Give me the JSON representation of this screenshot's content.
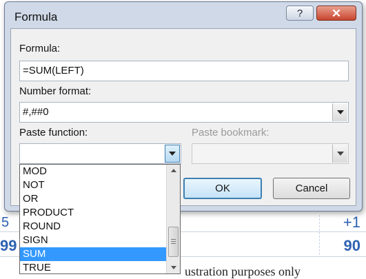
{
  "background_doc": {
    "cell_top": "234",
    "left_partial_a": "5",
    "right_value_a": "+1",
    "left_partial_b": "99",
    "right_value_b": "90",
    "caption_partial": "ustration purposes only"
  },
  "dialog": {
    "title": "Formula",
    "help_button": "?",
    "close_button": "✕",
    "formula_label": "Formula:",
    "formula_value": "=SUM(LEFT)",
    "number_format_label": "Number format:",
    "number_format_value": "#,##0",
    "paste_function_label": "Paste function:",
    "paste_function_value": "",
    "paste_bookmark_label": "Paste bookmark:",
    "paste_bookmark_value": "",
    "ok_label": "OK",
    "cancel_label": "Cancel"
  },
  "function_list": {
    "items": [
      "MOD",
      "NOT",
      "OR",
      "PRODUCT",
      "ROUND",
      "SIGN",
      "SUM",
      "TRUE"
    ],
    "selected": "SUM",
    "selected_color": "#3399ff"
  },
  "icons": {
    "dropdown": "chevron-down-icon",
    "scroll_up": "arrow-up-icon",
    "scroll_down": "arrow-down-icon"
  }
}
